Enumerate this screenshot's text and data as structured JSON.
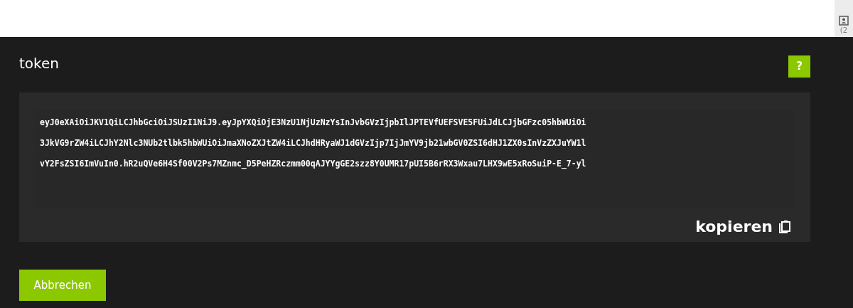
{
  "top_bar": {
    "side_tab_text": "(2"
  },
  "dialog": {
    "title": "token",
    "help_button": "?",
    "token_lines": [
      "eyJ0eXAiOiJKV1QiLCJhbGciOiJSUzI1NiJ9.eyJpYXQiOjE3NzU1NjUzNzYsInJvbGVzIjpbIlJPTEVfUEFSVE5FUiJdLCJjbGFzc05hbWUiOi",
      "3JkVG9rZW4iLCJhY2Nlc3NUb2tlbk5hbWUiOiJmaXNoZXJtZW4iLCJhdHRyaWJ1dGVzIjp7IjJmYV9jb21wbGV0ZSI6dHJ1ZX0sInVzZXJuYW1l",
      "vY2FsZSI6ImVuIn0.hR2uQVe6H4Sf00V2Ps7MZnmc_D5PeHZRczmm00qAJYYgGE2szz8Y0UMR17pUI5B6rRX3Wxau7LHX9wE5xRoSuiP-E_7-yl"
    ],
    "copy_label": "kopieren",
    "cancel_button": "Abbrechen"
  }
}
